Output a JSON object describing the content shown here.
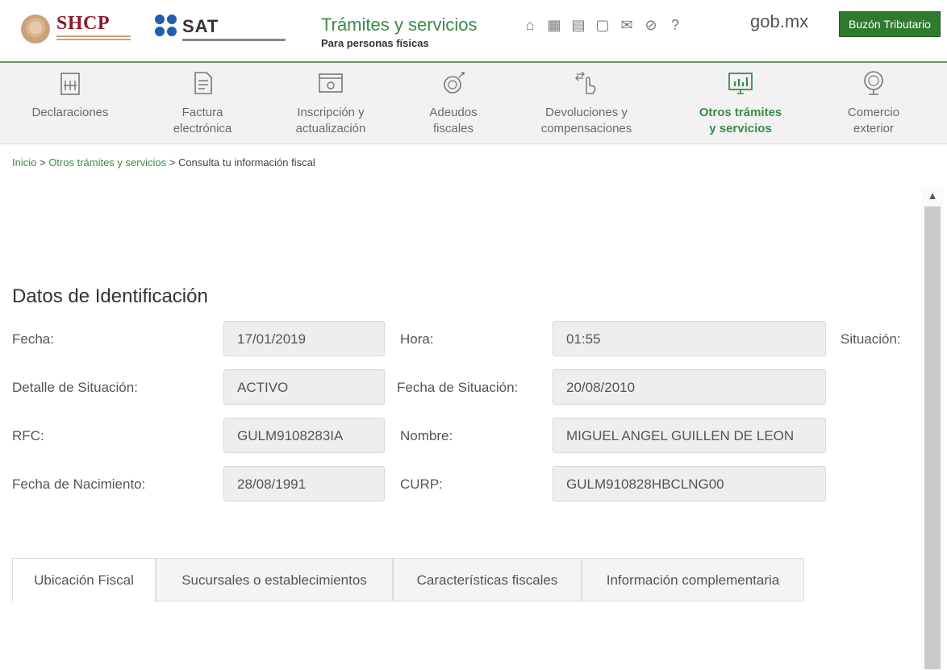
{
  "header": {
    "shcp_logo": "SHCP",
    "sat_logo": "SAT",
    "title": "Trámites y servicios",
    "subtitle": "Para personas físicas",
    "icons": [
      "home-icon",
      "calendar-grid-icon",
      "calendar-icon",
      "book-icon",
      "mail-icon",
      "compass-icon",
      "help-icon"
    ],
    "gob": "gob.mx",
    "buzon": "Buzón Tributario"
  },
  "nav": {
    "items": [
      {
        "label": "Declaraciones",
        "icon": "declaraciones-icon"
      },
      {
        "label": "Factura electrónica",
        "icon": "factura-icon"
      },
      {
        "label": "Inscripción y actualización",
        "icon": "inscripcion-icon"
      },
      {
        "label": "Adeudos fiscales",
        "icon": "adeudos-icon"
      },
      {
        "label": "Devoluciones y compensaciones",
        "icon": "devoluciones-icon"
      },
      {
        "label": "Otros trámites y servicios",
        "icon": "otros-tramites-icon",
        "active": true
      },
      {
        "label": "Comercio exterior",
        "icon": "comercio-exterior-icon"
      }
    ]
  },
  "breadcrumb": {
    "inicio": "Inicio",
    "sep": " > ",
    "otros": "Otros trámites y servicios",
    "current": "Consulta tu información fiscal"
  },
  "section": {
    "title": "Datos de Identificación",
    "fecha_label": "Fecha:",
    "fecha_value": "17/01/2019",
    "hora_label": "Hora:",
    "hora_value": "01:55",
    "situacion_label": "Situación:",
    "detalle_label": "Detalle de Situación:",
    "detalle_value": "ACTIVO",
    "fecha_situacion_label": "Fecha de Situación:",
    "fecha_situacion_value": "20/08/2010",
    "rfc_label": "RFC:",
    "rfc_value": "GULM9108283IA",
    "nombre_label": "Nombre:",
    "nombre_value": "MIGUEL ANGEL GUILLEN DE LEON",
    "nacimiento_label": "Fecha de Nacimiento:",
    "nacimiento_value": "28/08/1991",
    "curp_label": "CURP:",
    "curp_value": "GULM910828HBCLNG00"
  },
  "tabs": [
    {
      "label": "Ubicación Fiscal",
      "active": true
    },
    {
      "label": "Sucursales o establecimientos"
    },
    {
      "label": "Características fiscales"
    },
    {
      "label": "Información complementaria"
    }
  ],
  "colors": {
    "accent": "#3b8a4a",
    "brand_shcp": "#8b1a2a",
    "brand_sat": "#1f5fae",
    "buzon": "#2f7a2f"
  }
}
